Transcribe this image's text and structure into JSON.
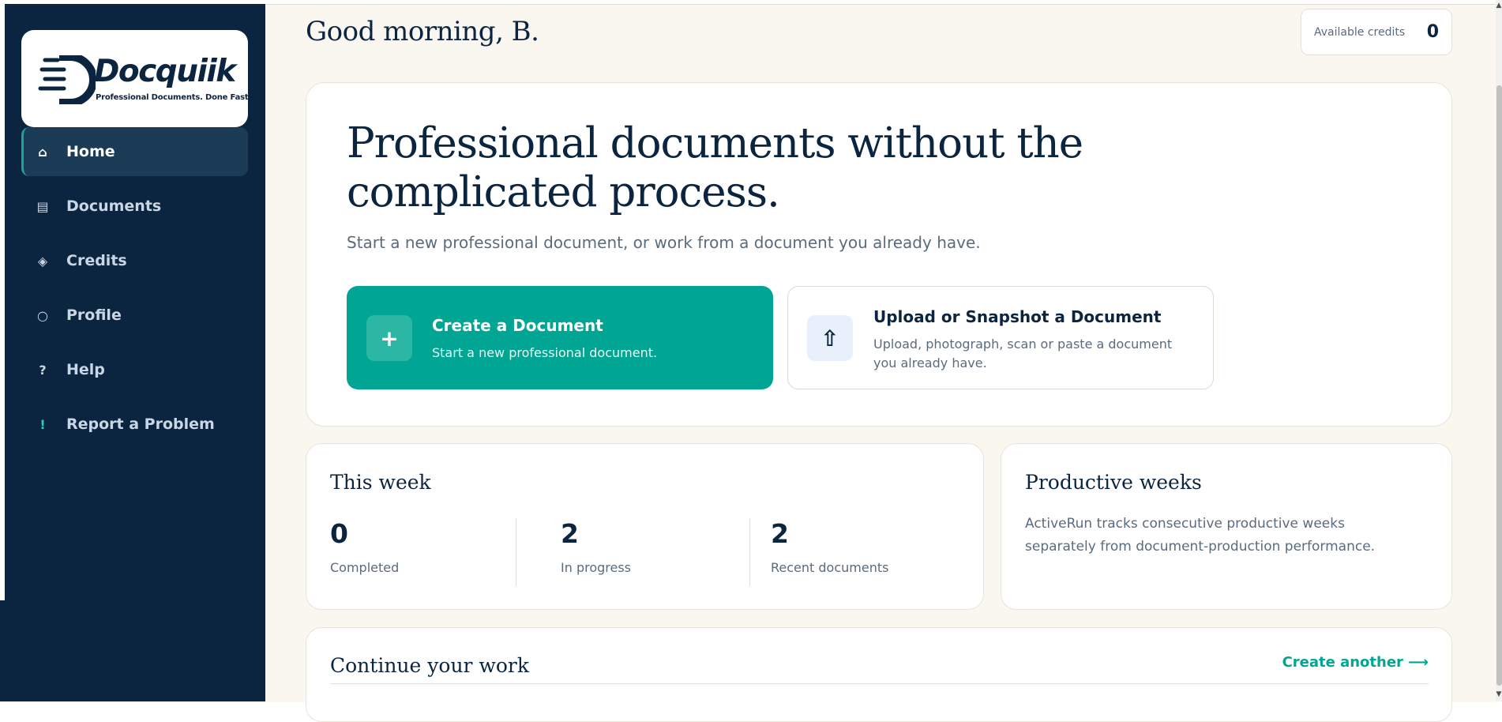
{
  "sidebar": {
    "logo": {
      "name": "Docquiik",
      "tagline": "Professional Documents. Done Faster."
    },
    "items": [
      {
        "label": "Home",
        "icon": "home-icon",
        "active": true
      },
      {
        "label": "Documents",
        "icon": "documents-icon"
      },
      {
        "label": "Credits",
        "icon": "diamond-icon"
      },
      {
        "label": "Profile",
        "icon": "profile-icon"
      },
      {
        "label": "Help",
        "icon": "help-icon"
      },
      {
        "label": "Report a Problem",
        "icon": "exclamation-icon"
      }
    ]
  },
  "header": {
    "greeting": "Good morning, B.",
    "credits_label": "Available credits",
    "credits_value": "0"
  },
  "hero": {
    "title": "Professional documents without the complicated process.",
    "subtitle": "Start a new professional document, or work from a document you already have.",
    "create": {
      "title": "Create a Document",
      "desc": "Start a new professional document."
    },
    "upload": {
      "title": "Upload or Snapshot a Document",
      "desc": "Upload, photograph, scan or paste a document you already have."
    }
  },
  "this_week": {
    "title": "This week",
    "stats": [
      {
        "value": "0",
        "label": "Completed"
      },
      {
        "value": "2",
        "label": "In progress"
      },
      {
        "value": "2",
        "label": "Recent documents"
      }
    ]
  },
  "productive": {
    "title": "Productive weeks",
    "text": "ActiveRun tracks consecutive productive weeks separately from document-production performance."
  },
  "continue": {
    "title": "Continue your work",
    "link": "Create another ⟶"
  },
  "colors": {
    "navy": "#0b2540",
    "teal": "#00a693",
    "background": "#faf7f1"
  }
}
